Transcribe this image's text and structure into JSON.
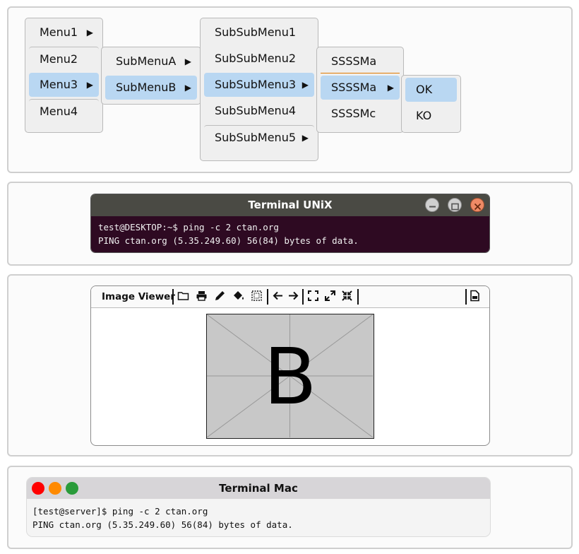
{
  "menus": {
    "level1": [
      "Menu1",
      "Menu2",
      "Menu3",
      "Menu4"
    ],
    "level2": [
      "SubMenuA",
      "SubMenuB"
    ],
    "level3": [
      "SubSubMenu1",
      "SubSubMenu2",
      "SubSubMenu3",
      "SubSubMenu4",
      "SubSubMenu5"
    ],
    "level4": [
      "SSSSMa",
      "SSSSMa",
      "SSSSMc"
    ],
    "level5": [
      "OK",
      "KO"
    ],
    "highlight_color": "#b9d7f2"
  },
  "terminal_unix": {
    "title": "Terminal UNiX",
    "lines": [
      "test@DESKTOP:~$ ping -c 2 ctan.org",
      "PING ctan.org (5.35.249.60) 56(84) bytes of data."
    ],
    "colors": {
      "titlebar": "#4a4a44",
      "background": "#2e0a22"
    },
    "buttons": [
      "minimize-icon",
      "maximize-icon",
      "close-icon"
    ]
  },
  "image_viewer": {
    "title": "Image Viewer",
    "toolbar_icons": [
      "folder-icon",
      "print-icon",
      "pencil-icon",
      "paint-bucket-icon",
      "selection-icon",
      "arrow-left-icon",
      "arrow-right-icon",
      "fit-screen-icon",
      "expand-icon",
      "shrink-icon",
      "file-image-icon"
    ],
    "image_letter": "B"
  },
  "terminal_mac": {
    "title": "Terminal Mac",
    "lines": [
      "[test@server]$ ping -c 2 ctan.org",
      "PING ctan.org (5.35.249.60) 56(84) bytes of data."
    ],
    "dot_colors": [
      "#ff0000",
      "#ff8a00",
      "#2a9b3a"
    ]
  }
}
